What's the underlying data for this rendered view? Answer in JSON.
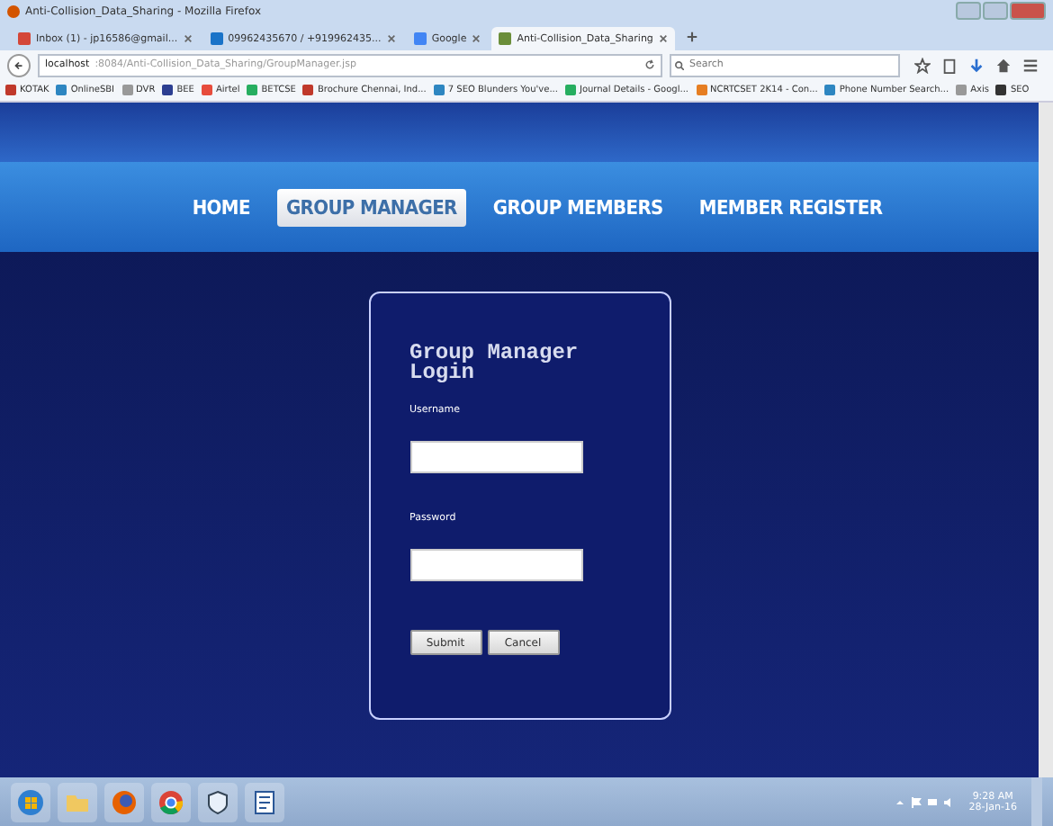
{
  "window": {
    "title": "Anti-Collision_Data_Sharing - Mozilla Firefox"
  },
  "tabs": [
    {
      "label": "Inbox (1) - jp16586@gmail...",
      "kind": "mail",
      "selected": false
    },
    {
      "label": "09962435670 / +919962435...",
      "kind": "phone",
      "selected": false
    },
    {
      "label": "Google",
      "kind": "google",
      "selected": false
    },
    {
      "label": "Anti-Collision_Data_Sharing",
      "kind": "page",
      "selected": true
    }
  ],
  "address_bar": {
    "host": "localhost",
    "path": ":8084/Anti-Collision_Data_Sharing/GroupManager.jsp"
  },
  "search": {
    "placeholder": "Search"
  },
  "bookmarks": [
    {
      "label": "KOTAK",
      "color": "#c0392b"
    },
    {
      "label": "OnlineSBI",
      "color": "#2e86c1"
    },
    {
      "label": "DVR",
      "color": "#999999"
    },
    {
      "label": "BEE",
      "color": "#2c3e91"
    },
    {
      "label": "Airtel",
      "color": "#e74c3c"
    },
    {
      "label": "BETCSE",
      "color": "#27ae60"
    },
    {
      "label": "Brochure Chennai, Ind...",
      "color": "#c0392b"
    },
    {
      "label": "7 SEO Blunders You've...",
      "color": "#2e86c1"
    },
    {
      "label": "Journal Details - Googl...",
      "color": "#27ae60"
    },
    {
      "label": "NCRTCSET 2K14 - Con...",
      "color": "#e67e22"
    },
    {
      "label": "Phone Number Search...",
      "color": "#2e86c1"
    },
    {
      "label": "Axis",
      "color": "#999999"
    },
    {
      "label": "SEO",
      "color": "#333333"
    }
  ],
  "nav": [
    {
      "label": "HOME",
      "selected": false
    },
    {
      "label": "GROUP MANAGER",
      "selected": true
    },
    {
      "label": "GROUP MEMBERS",
      "selected": false
    },
    {
      "label": "MEMBER REGISTER",
      "selected": false
    }
  ],
  "login": {
    "title": "Group Manager Login",
    "fields": [
      {
        "label": "Username"
      },
      {
        "label": "Password"
      }
    ],
    "buttons": [
      "Submit",
      "Cancel"
    ]
  },
  "taskbar": {
    "apps": [
      {
        "kind": "windows"
      },
      {
        "kind": "folder"
      },
      {
        "kind": "firefox"
      },
      {
        "kind": "chrome"
      },
      {
        "kind": "shield"
      },
      {
        "kind": "word"
      }
    ],
    "time": "9:28 AM",
    "date": "28-Jan-16"
  }
}
